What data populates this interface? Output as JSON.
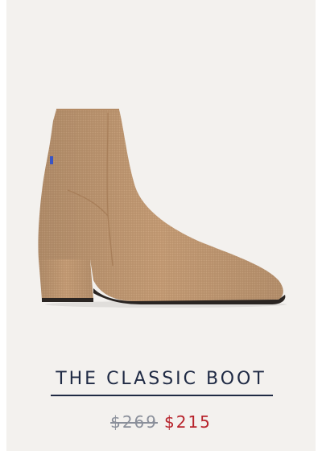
{
  "product": {
    "title": "THE CLASSIC BOOT",
    "original_price": "$269",
    "sale_price": "$215",
    "image_icon": "ankle-boot-image"
  },
  "colors": {
    "card_background": "#f3f1ee",
    "title": "#1f2a44",
    "original_price": "#8a8f9a",
    "sale_price": "#b7232b",
    "boot_knit": "#c29a74",
    "sole": "#2a2522",
    "heel_tab": "#3a55c4"
  }
}
